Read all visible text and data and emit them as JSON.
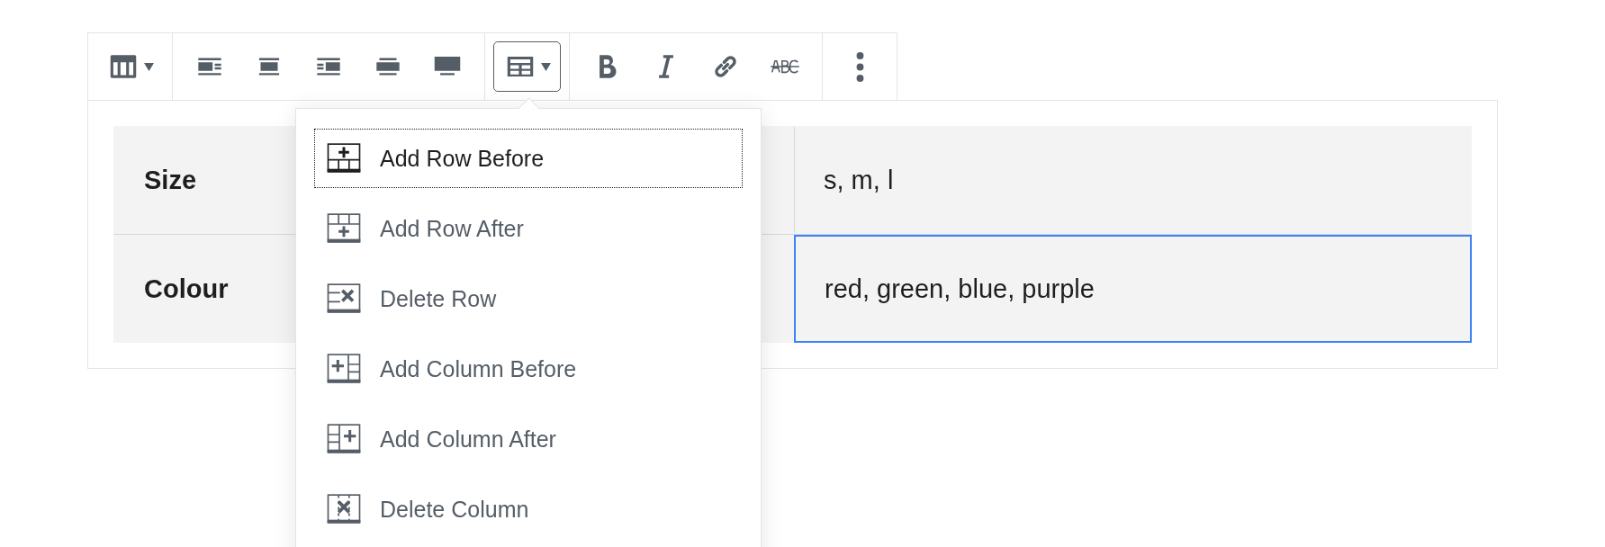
{
  "toolbar": {
    "groups": [
      {
        "buttons": [
          {
            "kind": "table",
            "caret": true,
            "selected": false
          }
        ]
      },
      {
        "buttons": [
          {
            "kind": "align-left",
            "caret": false,
            "selected": false
          },
          {
            "kind": "align-center",
            "caret": false,
            "selected": false
          },
          {
            "kind": "align-right",
            "caret": false,
            "selected": false
          },
          {
            "kind": "align-wide",
            "caret": false,
            "selected": false
          },
          {
            "kind": "align-full",
            "caret": false,
            "selected": false
          }
        ]
      },
      {
        "buttons": [
          {
            "kind": "table-edit",
            "caret": true,
            "selected": true
          }
        ]
      },
      {
        "buttons": [
          {
            "kind": "bold",
            "caret": false,
            "selected": false
          },
          {
            "kind": "italic",
            "caret": false,
            "selected": false
          },
          {
            "kind": "link",
            "caret": false,
            "selected": false
          },
          {
            "kind": "strikethrough",
            "caret": false,
            "selected": false
          }
        ]
      },
      {
        "buttons": [
          {
            "kind": "more",
            "caret": false,
            "selected": false
          }
        ]
      }
    ]
  },
  "table": {
    "rows": [
      {
        "cells": [
          {
            "text": "Size",
            "header": true,
            "selected": false
          },
          {
            "text": "s, m, l",
            "header": false,
            "selected": false
          }
        ]
      },
      {
        "cells": [
          {
            "text": "Colour",
            "header": true,
            "selected": false
          },
          {
            "text": "red, green, blue, purple",
            "header": false,
            "selected": true
          }
        ]
      }
    ]
  },
  "menu": {
    "items": [
      {
        "kind": "row-before",
        "label": "Add Row Before",
        "focused": true
      },
      {
        "kind": "row-after",
        "label": "Add Row After",
        "focused": false
      },
      {
        "kind": "row-delete",
        "label": "Delete Row",
        "focused": false
      },
      {
        "kind": "col-before",
        "label": "Add Column Before",
        "focused": false
      },
      {
        "kind": "col-after",
        "label": "Add Column After",
        "focused": false
      },
      {
        "kind": "col-delete",
        "label": "Delete Column",
        "focused": false
      }
    ]
  }
}
